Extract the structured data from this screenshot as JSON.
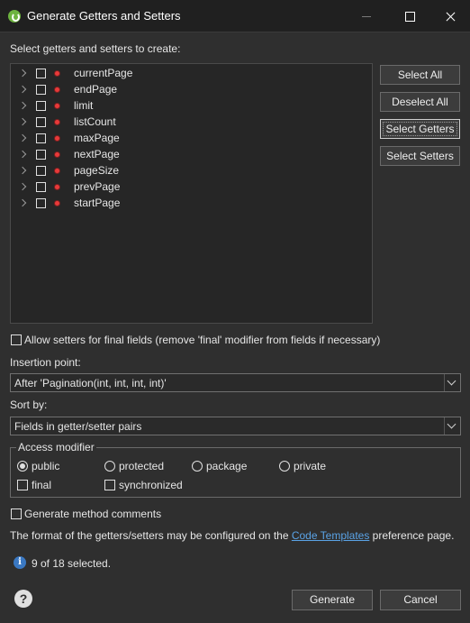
{
  "window": {
    "title": "Generate Getters and Setters"
  },
  "prompt": "Select getters and setters to create:",
  "fields": [
    {
      "name": "currentPage"
    },
    {
      "name": "endPage"
    },
    {
      "name": "limit"
    },
    {
      "name": "listCount"
    },
    {
      "name": "maxPage"
    },
    {
      "name": "nextPage"
    },
    {
      "name": "pageSize"
    },
    {
      "name": "prevPage"
    },
    {
      "name": "startPage"
    }
  ],
  "side_buttons": {
    "select_all": "Select All",
    "deselect_all": "Deselect All",
    "select_getters": "Select Getters",
    "select_setters": "Select Setters"
  },
  "allow_setters_final": {
    "label": "Allow setters for final fields (remove 'final' modifier from fields if necessary)",
    "checked": false
  },
  "insertion_point": {
    "label": "Insertion point:",
    "value": "After 'Pagination(int, int, int, int)'"
  },
  "sort_by": {
    "label": "Sort by:",
    "value": "Fields in getter/setter pairs"
  },
  "access_modifier": {
    "legend": "Access modifier",
    "options": [
      "public",
      "protected",
      "package",
      "private"
    ],
    "selected": "public",
    "final_label": "final",
    "synchronized_label": "synchronized"
  },
  "generate_comments": {
    "label": "Generate method comments",
    "checked": false
  },
  "template_note": {
    "before": "The format of the getters/setters may be configured on the ",
    "link": "Code Templates",
    "after": " preference page."
  },
  "status": "9 of 18 selected.",
  "footer": {
    "generate": "Generate",
    "cancel": "Cancel"
  },
  "colors": {
    "background": "#2f2f2f",
    "field_icon": "#e83a3a",
    "link": "#5aa3e6",
    "info": "#3a78c2"
  }
}
